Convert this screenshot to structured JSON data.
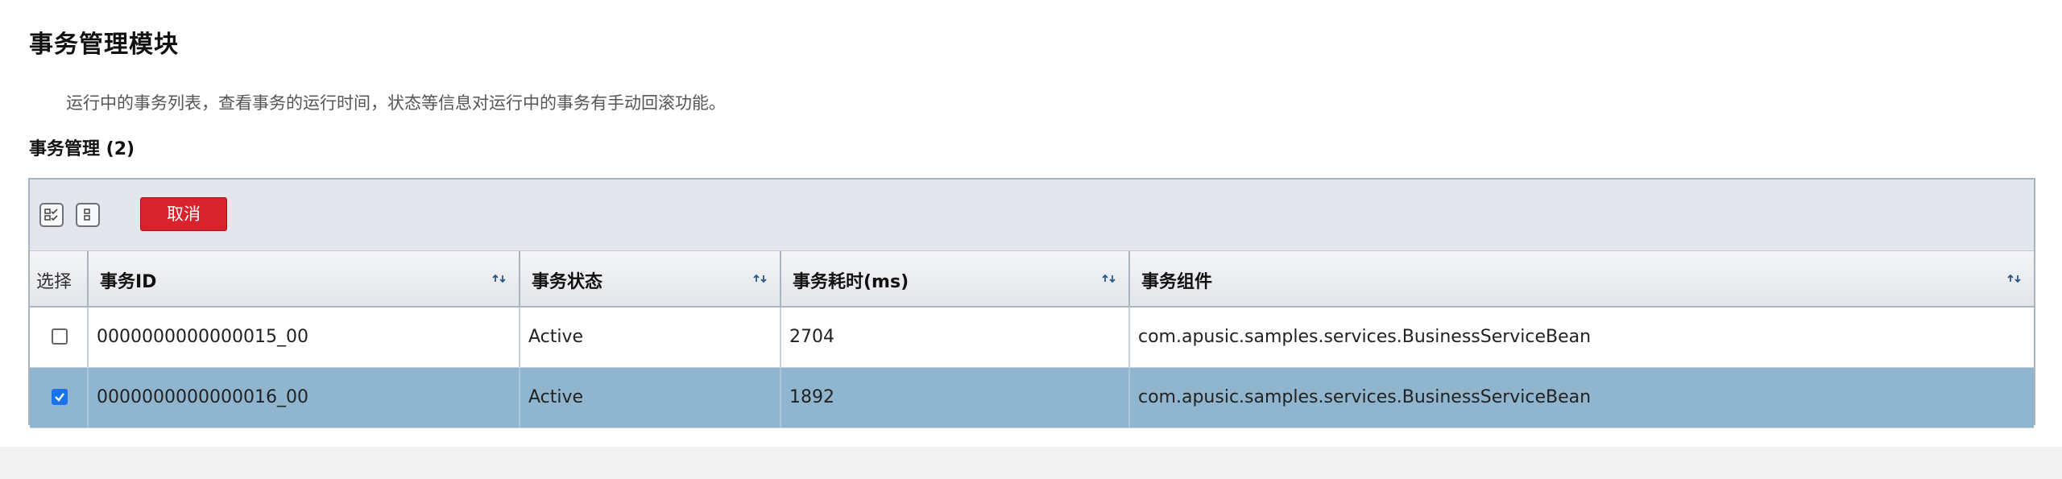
{
  "page": {
    "title": "事务管理模块",
    "description": "运行中的事务列表，查看事务的运行时间，状态等信息对运行中的事务有手动回滚功能。"
  },
  "section": {
    "title": "事务管理 (2)"
  },
  "toolbar": {
    "select_all_icon": "select-all-icon",
    "deselect_icon": "deselect-icon",
    "cancel_label": "取消",
    "cancel_color": "#d9232c"
  },
  "table": {
    "columns": {
      "select": "选择",
      "id": "事务ID",
      "status": "事务状态",
      "elapsed": "事务耗时(ms)",
      "component": "事务组件"
    },
    "rows": [
      {
        "checked": false,
        "id": "0000000000000015_00",
        "status": "Active",
        "elapsed": "2704",
        "component": "com.apusic.samples.services.BusinessServiceBean"
      },
      {
        "checked": true,
        "id": "0000000000000016_00",
        "status": "Active",
        "elapsed": "1892",
        "component": "com.apusic.samples.services.BusinessServiceBean"
      }
    ],
    "selected_row_color": "#8fb5cf"
  }
}
